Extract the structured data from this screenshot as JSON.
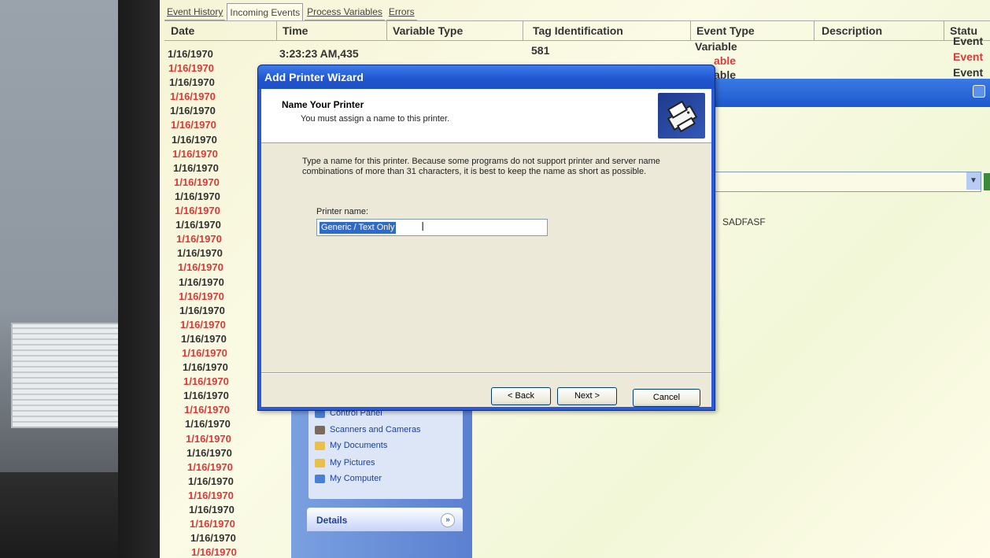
{
  "tabs": [
    {
      "label": "Event History",
      "active": false
    },
    {
      "label": "Incoming Events",
      "active": true
    },
    {
      "label": "Process Variables",
      "active": false
    },
    {
      "label": "Errors",
      "active": false
    }
  ],
  "grid": {
    "headers": {
      "date": "Date",
      "time": "Time",
      "variable_type": "Variable Type",
      "tag": "Tag Identification",
      "event_type": "Event Type",
      "description": "Description",
      "status": "Statu"
    },
    "first_row": {
      "time": "3:23:23 AM,435",
      "tag": "581"
    },
    "event_type_col": [
      {
        "text": "Variable",
        "color": "#333333"
      },
      {
        "text": "able",
        "color": "#d83a3a"
      },
      {
        "text": "able",
        "color": "#333333"
      }
    ],
    "status_col": [
      {
        "text": "Event",
        "color": "#333333"
      },
      {
        "text": "Event",
        "color": "#d83a3a"
      },
      {
        "text": "Event",
        "color": "#333333"
      }
    ],
    "dates": [
      "1/16/1970",
      "1/16/1970",
      "1/16/1970",
      "1/16/1970",
      "1/16/1970",
      "1/16/1970",
      "1/16/1970",
      "1/16/1970",
      "1/16/1970",
      "1/16/1970",
      "1/16/1970",
      "1/16/1970",
      "1/16/1970",
      "1/16/1970",
      "1/16/1970",
      "1/16/1970",
      "1/16/1970",
      "1/16/1970",
      "1/16/1970",
      "1/16/1970",
      "1/16/1970",
      "1/16/1970",
      "1/16/1970",
      "1/16/1970",
      "1/16/1970",
      "1/16/1970",
      "1/16/1970",
      "1/16/1970",
      "1/16/1970",
      "1/16/1970",
      "1/16/1970",
      "1/16/1970",
      "1/16/1970",
      "1/16/1970",
      "1/16/1970",
      "1/16/1970",
      "1/16/1970"
    ],
    "date_colors": {
      "odd": "#333333",
      "even": "#d83a3a"
    }
  },
  "background_window": {
    "list_item": "SADFASF",
    "tasks": [
      {
        "label": "Control Panel",
        "icon": "control-panel-icon",
        "color": "#4a7fd4"
      },
      {
        "label": "Scanners and Cameras",
        "icon": "scanner-icon",
        "color": "#7a6a5a"
      },
      {
        "label": "My Documents",
        "icon": "folder-icon",
        "color": "#e8c04a"
      },
      {
        "label": "My Pictures",
        "icon": "pictures-icon",
        "color": "#e8c04a"
      },
      {
        "label": "My Computer",
        "icon": "computer-icon",
        "color": "#4a7fd4"
      }
    ],
    "details_label": "Details"
  },
  "wizard": {
    "title": "Add Printer Wizard",
    "heading": "Name Your Printer",
    "subheading": "You must assign a name to this printer.",
    "description": "Type a name for this printer. Because some programs do not support printer and server name combinations of more than 31 characters, it is best to keep the name as short as possible.",
    "field_label": "Printer name:",
    "field_value": "Generic / Text Only",
    "buttons": {
      "back": "< Back",
      "next": "Next >",
      "cancel": "Cancel"
    }
  }
}
